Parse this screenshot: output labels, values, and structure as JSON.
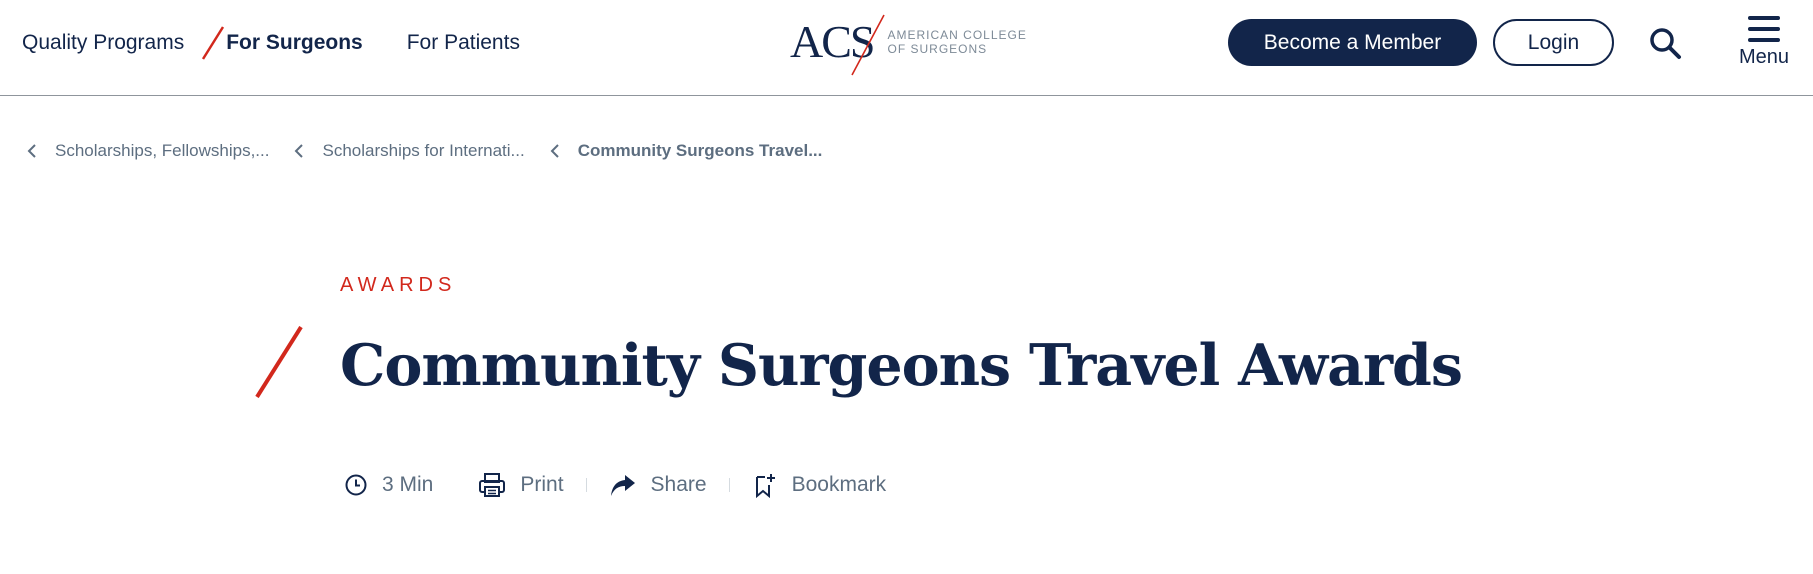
{
  "header": {
    "nav": [
      {
        "label": "Quality Programs"
      },
      {
        "label": "For Surgeons",
        "active": true
      },
      {
        "label": "For Patients"
      }
    ],
    "logo": {
      "mark": "ACS",
      "line1": "AMERICAN COLLEGE",
      "line2": "OF SURGEONS"
    },
    "member_button": "Become a Member",
    "login_button": "Login",
    "menu_label": "Menu"
  },
  "breadcrumb": [
    {
      "label": "Scholarships, Fellowships,..."
    },
    {
      "label": "Scholarships for Internati..."
    },
    {
      "label": "Community Surgeons Travel..."
    }
  ],
  "page": {
    "eyebrow": "AWARDS",
    "title": "Community Surgeons Travel Awards",
    "read_time": "3 Min",
    "print": "Print",
    "share": "Share",
    "bookmark": "Bookmark"
  },
  "colors": {
    "navy": "#12254a",
    "accent_red": "#d2281c",
    "muted": "#5d6e80"
  },
  "icons": [
    "search-icon",
    "menu-icon",
    "chevron-left-icon",
    "clock-icon",
    "print-icon",
    "share-icon",
    "bookmark-icon"
  ]
}
